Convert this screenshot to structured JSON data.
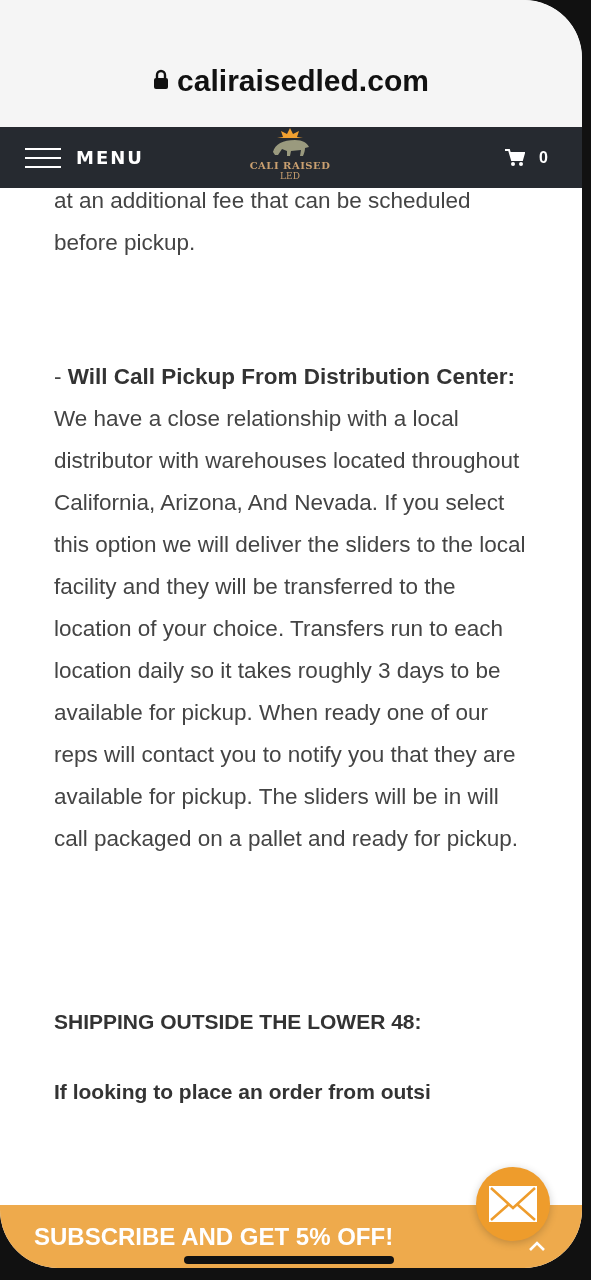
{
  "address_bar": {
    "url": "caliraisedled.com"
  },
  "nav": {
    "menu_label": "MENU",
    "logo": {
      "name": "CALI RAISED",
      "sub": "LED"
    },
    "cart_count": "0"
  },
  "content": [
    {
      "kind": "para",
      "text": "at an additional fee that can be scheduled before pickup."
    },
    {
      "kind": "para",
      "text": "- **Will Call Pickup From Distribution Center:** We have a close relationship with a local distributor with warehouses located throughout California, Arizona, And Nevada. If you select this option we will deliver the sliders to the local facility and they will be transferred to the location of your choice. Transfers run to each location daily so it takes roughly 3 days to be available for pickup. When ready one of our reps will contact you to notify you that they are available for pickup. The sliders will be in will call packaged on a pallet and ready for pickup."
    },
    {
      "kind": "heading",
      "text": "SHIPPING OUTSIDE THE LOWER 48:"
    },
    {
      "kind": "lead",
      "text": "If looking to place an order from outsi"
    }
  ],
  "subscribe_bar": {
    "label": "SUBSCRIBE AND GET 5% OFF!"
  }
}
